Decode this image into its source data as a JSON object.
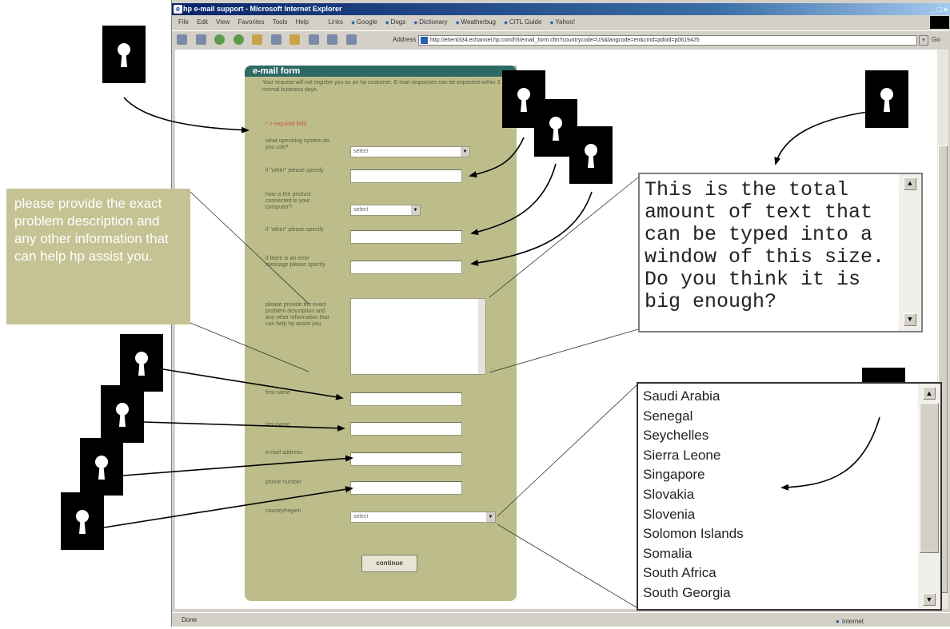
{
  "window": {
    "title": "hp e-mail support - Microsoft Internet Explorer",
    "window_controls": "_ □ ×"
  },
  "menu": [
    "File",
    "Edit",
    "View",
    "Favorites",
    "Tools",
    "Help"
  ],
  "links": {
    "label": "Links",
    "items": [
      "Google",
      "Dogs",
      "Dictionary",
      "Weatherbug",
      "CITL Guide",
      "Yahoo!"
    ]
  },
  "toolbar": {
    "address_label": "Address",
    "address_url": "http://ehent334.echannel.hp.com/h5/email_form.cfm?countrycode=US&langcode=en&cmd=pdoid=p0619425",
    "go_label": "Go"
  },
  "status": {
    "left": "Done",
    "zone": "Internet"
  },
  "form": {
    "header": "e-mail form",
    "intro": "Your request will not register you as an hp customer. E-mail responses can be expected within 3 normal business days.",
    "required": "* = required field",
    "os_label": "what operating system do you use?",
    "os_value": "select",
    "os_other_label": "if \"other\" please specify",
    "connection_label": "how is the product connected to your computer?",
    "connection_value": "select",
    "connection_other_label": "if \"other\" please specify",
    "error_label": "if there is an error message please specify",
    "description_label": "please provide the exact problem description and any other information that can help hp assist you.",
    "first_name_label": "first name",
    "last_name_label": "last name",
    "email_label": "e-mail address",
    "phone_label": "phone number",
    "country_label": "country/region",
    "country_value": "select",
    "continue_label": "continue"
  },
  "callouts": {
    "note_text": "please provide the exact problem description and any other information that can help hp assist you.",
    "textarea_text": "This is the total amount of text that can be typed into a window of this size.  Do you think it is big enough?",
    "countries": [
      "Saudi Arabia",
      "Senegal",
      "Seychelles",
      "Sierra Leone",
      "Singapore",
      "Slovakia",
      "Slovenia",
      "Solomon Islands",
      "Somalia",
      "South Africa",
      "South Georgia"
    ]
  }
}
